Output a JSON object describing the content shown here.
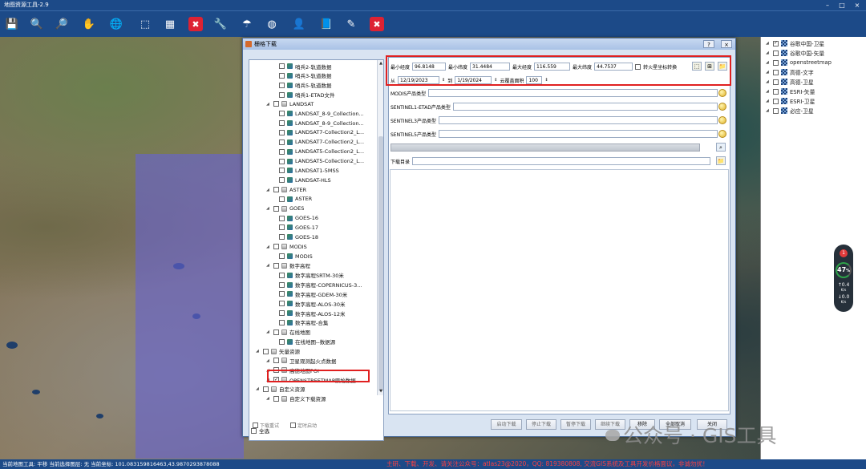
{
  "app": {
    "title": "地图资源工具-2.9"
  },
  "toolbar": {
    "buttons": [
      {
        "name": "save-icon",
        "glyph": "💾"
      },
      {
        "name": "zoom-in-icon",
        "glyph": "🔍"
      },
      {
        "name": "zoom-out-icon",
        "glyph": "🔎"
      },
      {
        "name": "pan-hand-icon",
        "glyph": "✋"
      },
      {
        "name": "globe-icon",
        "glyph": "🌐"
      },
      {
        "name": "select-icon",
        "glyph": "⬚"
      },
      {
        "name": "grid-icon",
        "glyph": "▦"
      },
      {
        "name": "clear-icon",
        "glyph": "✖"
      },
      {
        "name": "tool-icon",
        "glyph": "🔧"
      },
      {
        "name": "umbrella-icon",
        "glyph": "☂"
      },
      {
        "name": "sphere-icon",
        "glyph": "◍"
      },
      {
        "name": "user-icon",
        "glyph": "👤"
      },
      {
        "name": "book-icon",
        "glyph": "📘"
      },
      {
        "name": "pencil-icon",
        "glyph": "✎"
      },
      {
        "name": "exit-icon",
        "glyph": "✖"
      }
    ]
  },
  "layers": [
    {
      "label": "谷歌中国-卫星",
      "checked": true
    },
    {
      "label": "谷歌中国-矢量",
      "checked": false
    },
    {
      "label": "openstreetmap",
      "checked": false
    },
    {
      "label": "高德-文字",
      "checked": false
    },
    {
      "label": "高德-卫星",
      "checked": false
    },
    {
      "label": "ESRI-矢量",
      "checked": false
    },
    {
      "label": "ESRI-卫星",
      "checked": false
    },
    {
      "label": "必应-卫星",
      "checked": false
    }
  ],
  "speed": {
    "badge": "1",
    "percent": "47",
    "percent_unit": "%",
    "up": "0.4",
    "up_unit": "K/s",
    "down": "0.0",
    "down_unit": "K/s"
  },
  "dialog": {
    "title": "栅格下载",
    "help": "?",
    "close": "×",
    "tree": [
      {
        "label": "哨兵2-轨道数据",
        "level": 2,
        "type": "leaf",
        "checked": false
      },
      {
        "label": "哨兵3-轨道数据",
        "level": 2,
        "type": "leaf",
        "checked": false
      },
      {
        "label": "哨兵5-轨道数据",
        "level": 2,
        "type": "leaf",
        "checked": false
      },
      {
        "label": "哨兵1-ETAD文件",
        "level": 2,
        "type": "leaf",
        "checked": false
      },
      {
        "label": "LANDSAT",
        "level": 1,
        "type": "group",
        "checked": false
      },
      {
        "label": "LANDSAT_8-9_Collection...",
        "level": 2,
        "type": "leaf",
        "checked": false
      },
      {
        "label": "LANDSAT_8-9_Collection...",
        "level": 2,
        "type": "leaf",
        "checked": false
      },
      {
        "label": "LANDSAT7-Collection2_L...",
        "level": 2,
        "type": "leaf",
        "checked": false
      },
      {
        "label": "LANDSAT7-Collection2_L...",
        "level": 2,
        "type": "leaf",
        "checked": false
      },
      {
        "label": "LANDSAT5-Collection2_L...",
        "level": 2,
        "type": "leaf",
        "checked": false
      },
      {
        "label": "LANDSAT5-Collection2_L...",
        "level": 2,
        "type": "leaf",
        "checked": false
      },
      {
        "label": "LANDSAT1-5MSS",
        "level": 2,
        "type": "leaf",
        "checked": false
      },
      {
        "label": "LANDSAT-HLS",
        "level": 2,
        "type": "leaf",
        "checked": false
      },
      {
        "label": "ASTER",
        "level": 1,
        "type": "group",
        "checked": false
      },
      {
        "label": "ASTER",
        "level": 2,
        "type": "leaf",
        "checked": false
      },
      {
        "label": "GOES",
        "level": 1,
        "type": "group",
        "checked": false
      },
      {
        "label": "GOES-16",
        "level": 2,
        "type": "leaf",
        "checked": false
      },
      {
        "label": "GOES-17",
        "level": 2,
        "type": "leaf",
        "checked": false
      },
      {
        "label": "GOES-18",
        "level": 2,
        "type": "leaf",
        "checked": false
      },
      {
        "label": "MODIS",
        "level": 1,
        "type": "group",
        "checked": false
      },
      {
        "label": "MODIS",
        "level": 2,
        "type": "leaf",
        "checked": false
      },
      {
        "label": "数字高程",
        "level": 1,
        "type": "group",
        "checked": false
      },
      {
        "label": "数字高程SRTM-30米",
        "level": 2,
        "type": "leaf",
        "checked": false
      },
      {
        "label": "数字高程-COPERNICUS-3...",
        "level": 2,
        "type": "leaf",
        "checked": false
      },
      {
        "label": "数字高程-GDEM-30米",
        "level": 2,
        "type": "leaf",
        "checked": false
      },
      {
        "label": "数字高程-ALOS-30米",
        "level": 2,
        "type": "leaf",
        "checked": false
      },
      {
        "label": "数字高程-ALOS-12米",
        "level": 2,
        "type": "leaf",
        "checked": false
      },
      {
        "label": "数字高程-合集",
        "level": 2,
        "type": "leaf",
        "checked": false
      },
      {
        "label": "在线地图",
        "level": 1,
        "type": "group",
        "checked": false
      },
      {
        "label": "在线地图--数据源",
        "level": 2,
        "type": "leaf",
        "checked": false
      },
      {
        "label": "矢量资源",
        "level": 0,
        "type": "group",
        "checked": false
      },
      {
        "label": "卫星观测起火点数据",
        "level": 1,
        "type": "group",
        "checked": false
      },
      {
        "label": "高德地图POI",
        "level": 1,
        "type": "group",
        "checked": false
      },
      {
        "label": "OPENSTREETMAP原始数据",
        "level": 1,
        "type": "group",
        "checked": true
      },
      {
        "label": "自定义资源",
        "level": 0,
        "type": "group",
        "checked": false
      },
      {
        "label": "自定义下载资源",
        "level": 1,
        "type": "group",
        "checked": false
      }
    ],
    "select_all": "全选",
    "bounds": {
      "min_lon_label": "最小经度",
      "min_lon": "96.8148",
      "min_lat_label": "最小纬度",
      "min_lat": "31.4484",
      "max_lon_label": "最大经度",
      "max_lon": "116.559",
      "max_lat_label": "最大纬度",
      "max_lat": "44.7537",
      "mars_label": "转火星坐标转换"
    },
    "dates": {
      "from_label": "从",
      "from": "12/19/2023",
      "to_label": "到",
      "to": "1/19/2024",
      "cloud_label": "云覆盖面积",
      "cloud": "100"
    },
    "product_rows": [
      {
        "label": "MODIS产品类型"
      },
      {
        "label": "SENTINEL1-ETAD产品类型"
      },
      {
        "label": "SENTINEL3产品类型"
      },
      {
        "label": "SENTINEL5产品类型"
      }
    ],
    "dir_label": "下载目录",
    "options": {
      "retry": "下载重试",
      "timer": "定时启动"
    },
    "buttons": {
      "start": "启动下载",
      "stop": "停止下载",
      "pause": "暂停下载",
      "resume": "继续下载",
      "remove": "移除",
      "remove_all": "全部取消",
      "close": "关闭"
    }
  },
  "status": {
    "text": "当前地图工具: 平移  当前选择图层: 无  当前坐标: 101.083159816463,43.9870293878088",
    "marquee": "主研、下载、开发、请关注公众号：atlas23@2020，QQ: 819380808, 交流GIS系统及工具开发价格面议，非诚勿扰！"
  },
  "watermark": "公众号 · GIS工具",
  "colors": {
    "accent": "#1c4a88",
    "highlight_box": "#e02020",
    "overlay": "#6662d2"
  }
}
